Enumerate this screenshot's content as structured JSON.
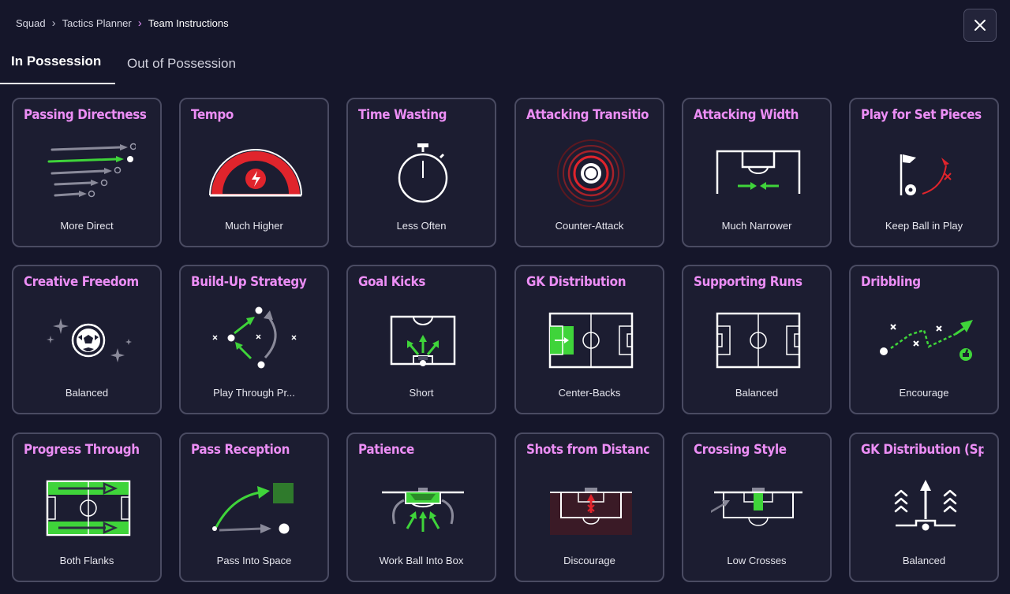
{
  "breadcrumb": {
    "items": [
      "Squad",
      "Tactics Planner",
      "Team Instructions"
    ]
  },
  "tabs": [
    {
      "label": "In Possession",
      "active": true
    },
    {
      "label": "Out of Possession",
      "active": false
    }
  ],
  "colors": {
    "accent": "#ec8ef5",
    "green": "#3fd43a",
    "red": "#e0242c",
    "card_bg": "#1c1d31",
    "border": "#4a4b62"
  },
  "cards": [
    {
      "title": "Passing Directness",
      "value": "More Direct",
      "icon": "direct-passes-icon"
    },
    {
      "title": "Tempo",
      "value": "Much Higher",
      "icon": "tempo-gauge-icon"
    },
    {
      "title": "Time Wasting",
      "value": "Less Often",
      "icon": "stopwatch-icon"
    },
    {
      "title": "Attacking Transition",
      "value": "Counter-Attack",
      "icon": "counter-attack-rings-icon"
    },
    {
      "title": "Attacking Width",
      "value": "Much Narrower",
      "icon": "narrow-width-pitch-icon"
    },
    {
      "title": "Play for Set Pieces",
      "value": "Keep Ball in Play",
      "icon": "corner-flag-icon"
    },
    {
      "title": "Creative Freedom",
      "value": "Balanced",
      "icon": "sparkle-ball-icon"
    },
    {
      "title": "Build-Up Strategy",
      "value": "Play Through Pr...",
      "icon": "build-up-arrows-icon"
    },
    {
      "title": "Goal Kicks",
      "value": "Short",
      "icon": "goal-kick-pitch-icon"
    },
    {
      "title": "GK Distribution",
      "value": "Center-Backs",
      "icon": "gk-distribution-pitch-icon"
    },
    {
      "title": "Supporting Runs",
      "value": "Balanced",
      "icon": "full-pitch-icon"
    },
    {
      "title": "Dribbling",
      "value": "Encourage",
      "icon": "dribble-path-icon"
    },
    {
      "title": "Progress Through",
      "value": "Both Flanks",
      "icon": "flanks-pitch-icon"
    },
    {
      "title": "Pass Reception",
      "value": "Pass Into Space",
      "icon": "pass-into-space-icon"
    },
    {
      "title": "Patience",
      "value": "Work Ball Into Box",
      "icon": "work-into-box-icon"
    },
    {
      "title": "Shots from Distance",
      "value": "Discourage",
      "icon": "no-long-shots-icon"
    },
    {
      "title": "Crossing Style",
      "value": "Low Crosses",
      "icon": "low-cross-icon"
    },
    {
      "title": "GK Distribution (Speed)",
      "value": "Balanced",
      "icon": "gk-speed-chevrons-icon"
    }
  ]
}
